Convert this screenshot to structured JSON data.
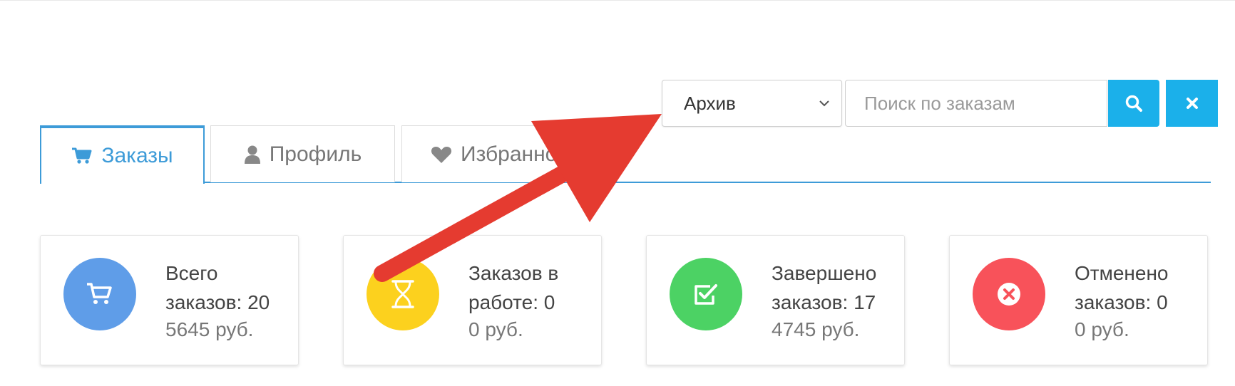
{
  "filter": {
    "selected": "Архив"
  },
  "search": {
    "placeholder": "Поиск по заказам"
  },
  "tabs": [
    {
      "label": "Заказы",
      "icon": "cart-icon",
      "active": true
    },
    {
      "label": "Профиль",
      "icon": "user-icon",
      "active": false
    },
    {
      "label": "Избранное",
      "icon": "heart-icon",
      "active": false
    }
  ],
  "stats": [
    {
      "title": "Всего заказов: 20",
      "sum": "5645 руб.",
      "color": "#5f9de8",
      "icon": "cart-icon"
    },
    {
      "title": "Заказов в работе: 0",
      "sum": "0 руб.",
      "color": "#fcd11e",
      "icon": "hourglass-icon"
    },
    {
      "title": "Завершено заказов: 17",
      "sum": "4745 руб.",
      "color": "#4cd264",
      "icon": "check-square-icon"
    },
    {
      "title": "Отменено заказов: 0",
      "sum": "0 руб.",
      "color": "#f8525a",
      "icon": "x-circle-icon"
    }
  ],
  "colors": {
    "accent": "#1bb0ea",
    "tab_active": "#3d9bd8",
    "annotation_arrow": "#e53b30"
  }
}
